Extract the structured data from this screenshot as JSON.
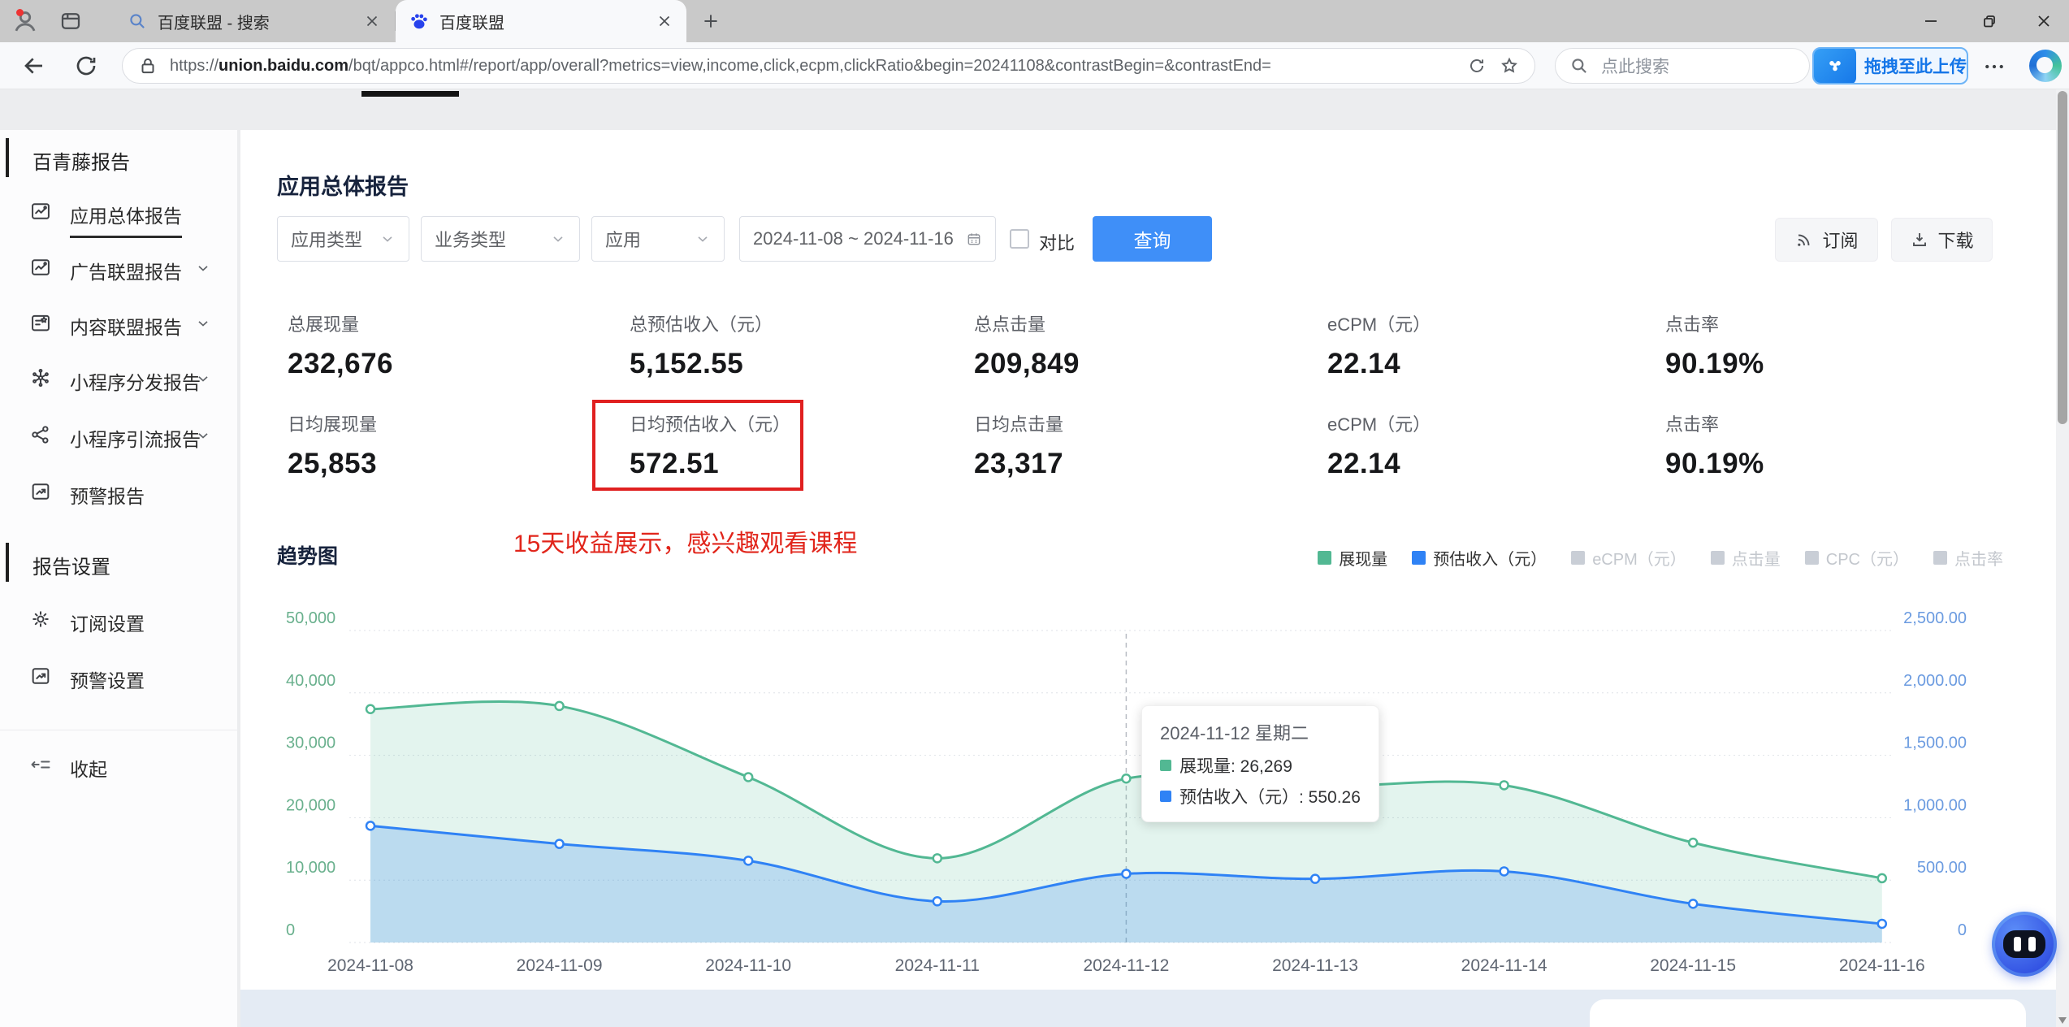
{
  "browser": {
    "tabs": [
      {
        "title": "百度联盟 - 搜索"
      },
      {
        "title": "百度联盟"
      }
    ],
    "url_scheme": "https://",
    "url_domain": "union.baidu.com",
    "url_path": "/bqt/appco.html#/report/app/overall?metrics=view,income,click,ecpm,clickRatio&begin=20241108&contrastBegin=&contrastEnd=",
    "search_placeholder": "点此搜索",
    "upload_label": "拖拽至此上传"
  },
  "sidebar": {
    "sections": [
      {
        "header": "百青藤报告",
        "items": [
          {
            "label": "应用总体报告",
            "icon": "report",
            "active": true,
            "chevron": false
          },
          {
            "label": "广告联盟报告",
            "icon": "ad",
            "active": false,
            "chevron": true
          },
          {
            "label": "内容联盟报告",
            "icon": "content",
            "active": false,
            "chevron": true
          },
          {
            "label": "小程序分发报告",
            "icon": "miniapp",
            "active": false,
            "chevron": true
          },
          {
            "label": "小程序引流报告",
            "icon": "share",
            "active": false,
            "chevron": true
          },
          {
            "label": "预警报告",
            "icon": "alert",
            "active": false,
            "chevron": false
          }
        ]
      },
      {
        "header": "报告设置",
        "items": [
          {
            "label": "订阅设置",
            "icon": "gear",
            "active": false,
            "chevron": false
          },
          {
            "label": "预警设置",
            "icon": "alert",
            "active": false,
            "chevron": false
          }
        ]
      }
    ],
    "collapse_label": "收起"
  },
  "page": {
    "title": "应用总体报告",
    "filters": {
      "app_type": "应用类型",
      "business_type": "业务类型",
      "app": "应用",
      "date_range": "2024-11-08 ~ 2024-11-16",
      "compare_label": "对比",
      "query_button": "查询",
      "subscribe_button": "订阅",
      "download_button": "下载"
    },
    "metrics": {
      "rows": [
        [
          {
            "label": "总展现量",
            "value": "232,676"
          },
          {
            "label": "总预估收入（元）",
            "value": "5,152.55"
          },
          {
            "label": "总点击量",
            "value": "209,849"
          },
          {
            "label": "eCPM（元）",
            "value": "22.14"
          },
          {
            "label": "点击率",
            "value": "90.19%"
          }
        ],
        [
          {
            "label": "日均展现量",
            "value": "25,853"
          },
          {
            "label": "日均预估收入（元）",
            "value": "572.51"
          },
          {
            "label": "日均点击量",
            "value": "23,317"
          },
          {
            "label": "eCPM（元）",
            "value": "22.14"
          },
          {
            "label": "点击率",
            "value": "90.19%"
          }
        ]
      ]
    },
    "annotation": "15天收益展示，感兴趣观看课程"
  },
  "chart_data": {
    "type": "area",
    "title": "趋势图",
    "x": [
      "2024-11-08",
      "2024-11-09",
      "2024-11-10",
      "2024-11-11",
      "2024-11-12",
      "2024-11-13",
      "2024-11-14",
      "2024-11-15",
      "2024-11-16"
    ],
    "series": [
      {
        "name": "展现量",
        "axis": "left",
        "color": "#52b893",
        "fill": "rgba(82,184,147,0.16)",
        "values": [
          37400,
          37900,
          26500,
          13500,
          26269,
          25000,
          25200,
          16000,
          10300
        ]
      },
      {
        "name": "预估收入（元）",
        "axis": "right",
        "color": "#2f82f5",
        "fill": "rgba(47,130,245,0.22)",
        "values": [
          935,
          790,
          655,
          330,
          550.26,
          510,
          570,
          310,
          150
        ]
      }
    ],
    "legend": [
      {
        "label": "展现量",
        "color": "#52b893",
        "active": true
      },
      {
        "label": "预估收入（元）",
        "color": "#2f82f5",
        "active": true
      },
      {
        "label": "eCPM（元）",
        "color": "#c9ced6",
        "active": false
      },
      {
        "label": "点击量",
        "color": "#c9ced6",
        "active": false
      },
      {
        "label": "CPC（元）",
        "color": "#c9ced6",
        "active": false
      },
      {
        "label": "点击率",
        "color": "#c9ced6",
        "active": false
      }
    ],
    "left_axis": {
      "ticks": [
        "50,000",
        "40,000",
        "30,000",
        "20,000",
        "10,000",
        "0"
      ],
      "max": 50000,
      "color": "#69b08d"
    },
    "right_axis": {
      "ticks": [
        "2,500.00",
        "2,000.00",
        "1,500.00",
        "1,000.00",
        "500.00",
        "0"
      ],
      "max": 2500,
      "color": "#6b9be0"
    },
    "grid": true,
    "hover_index": 4,
    "tooltip": {
      "date": "2024-11-12 星期二",
      "items": [
        {
          "name": "展现量",
          "value": "26,269",
          "color": "#52b893"
        },
        {
          "name": "预估收入（元）",
          "value": "550.26",
          "color": "#2f82f5"
        }
      ]
    }
  }
}
